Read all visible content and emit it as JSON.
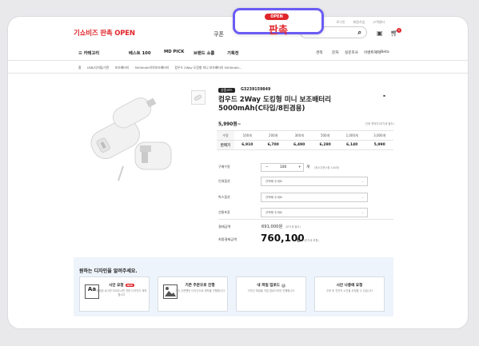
{
  "header": {
    "utils": [
      "로그인",
      "회원가입",
      "고객센터"
    ],
    "logo": "기쇼비즈 판촉 OPEN",
    "coupon": "쿠폰",
    "cart_count": "0"
  },
  "nav": {
    "category_label": "카테고리",
    "items": [
      "베스트 100",
      "MD PICK",
      "브랜드 쇼룸",
      "기획전"
    ],
    "right_items": [
      "견적",
      "문자",
      "실문조사",
      "이벤트혜택"
    ],
    "hot_label": "Beta"
  },
  "breadcrumbs": [
    "홈",
    "USB/디지털/가전",
    "보조배터리",
    "5000mAh이하보조배터리",
    "컴우드 2Way 도킹형 미니 보조배터리 5000mAh..."
  ],
  "badge": {
    "pill": "OPEN",
    "title": "판촉"
  },
  "product": {
    "code_label": "상품코드",
    "code": "G3239159849",
    "title": "컴우드 2Way 도킹형 미니 보조배터리 5000mAh(C타입/8핀겸용)",
    "price": "5,990원~",
    "price_note": "단위 판매가(부가세 별도)",
    "qty_table": {
      "row1_label": "수량",
      "row2_label": "판매가",
      "quantities": [
        "100개",
        "200개",
        "300개",
        "500개",
        "1,000개",
        "3,000개"
      ],
      "prices": [
        "6,910",
        "6,700",
        "6,490",
        "6,280",
        "6,140",
        "5,990"
      ]
    },
    "options": {
      "quantity_label": "구매수량",
      "quantity_value": "100",
      "quantity_unit": "개",
      "quantity_note": "(최소주문수량 100개)",
      "print_label": "인쇄옵션",
      "box_label": "박스옵션",
      "wrap_label": "선물포장",
      "select_placeholder": "선택해 주세요"
    },
    "summary": {
      "subtotal_label": "결제금액",
      "subtotal": "691,000원",
      "subtotal_note": "(부가세 별도)",
      "total_label": "최종결제금액",
      "total": "760,100",
      "total_won": "원",
      "total_note": "(부가세 포함)"
    }
  },
  "design": {
    "title": "원하는 디자인을 알려주세요.",
    "new_badge": "NEW",
    "cards": [
      {
        "title": "시안 요청",
        "desc": "준비된 로고만 보내주시면 전문 디자인이 제작합니다",
        "icon": "Aa"
      },
      {
        "title": "기존 주문으로 진행",
        "desc": "기존 주문했던 디자인으로 제작을 진행합니다",
        "icon": ""
      },
      {
        "title": "내 파일 업로드",
        "desc": "디자인 파일을 직접 업로드하여 진행합니다",
        "icon": ""
      },
      {
        "title": "시안 나중에 요청",
        "desc": "주문 후 천천히 시안을 요청할 수 있습니다",
        "icon": ""
      }
    ]
  }
}
